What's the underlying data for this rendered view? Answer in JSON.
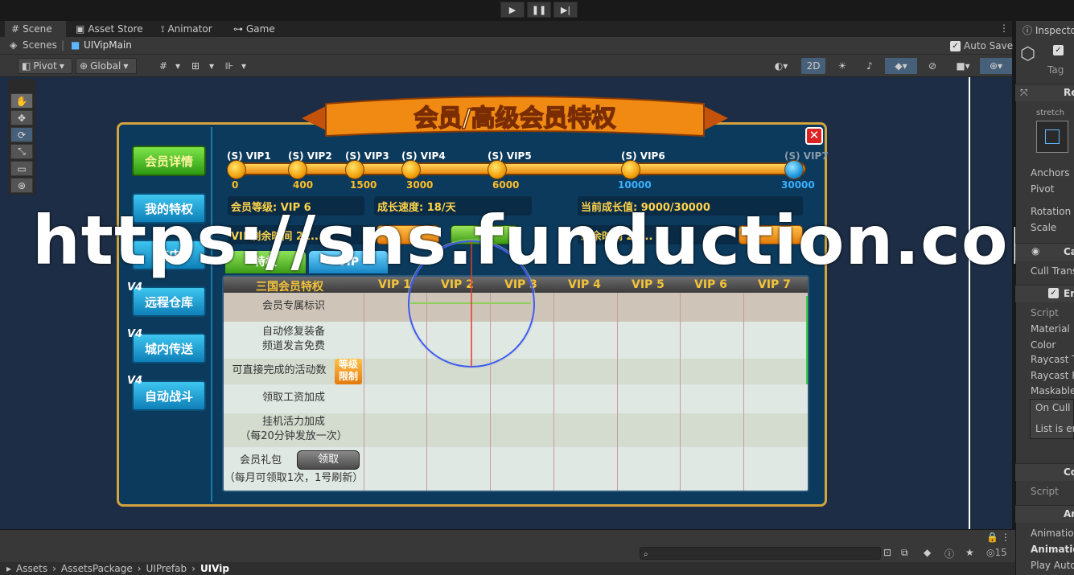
{
  "play_controls": {
    "play": "▶",
    "pause": "❚❚",
    "step": "▶|"
  },
  "tabs": [
    {
      "label": "Scene",
      "icon": "#"
    },
    {
      "label": "Asset Store",
      "icon": "🛍"
    },
    {
      "label": "Animator",
      "icon": "✈"
    },
    {
      "label": "Game",
      "icon": "🎮"
    }
  ],
  "breadcrumb": {
    "root": "Scenes",
    "current": "UIVipMain"
  },
  "auto_save": {
    "label": "Auto Save",
    "checked": true
  },
  "toolbar": {
    "pivot": "Pivot",
    "global": "Global",
    "mode_2d": "2D"
  },
  "game_ui": {
    "title": "会员/高级会员特权",
    "side_menu": [
      "会员详情",
      "我的特权",
      "商店",
      "远程仓库",
      "城内传送",
      "自动战斗"
    ],
    "badge": "V4",
    "vip_levels": [
      {
        "label": "VIP1",
        "value": "0"
      },
      {
        "label": "VIP2",
        "value": "400"
      },
      {
        "label": "VIP3",
        "value": "1500"
      },
      {
        "label": "VIP4",
        "value": "3000"
      },
      {
        "label": "VIP5",
        "value": "6000"
      },
      {
        "label": "VIP6",
        "value": "10000"
      },
      {
        "label": "VIP7",
        "value": "30000"
      }
    ],
    "s_prefix": "(S)",
    "member_level_label": "会员等级: VIP 6",
    "growth_speed_label": "成长速度: 18/天",
    "current_growth_label": "当前成长值: 9000/30000",
    "vip_remaining_label": "VIP剩余时间  22...",
    "remaining_label2": "剩余时间  22...",
    "sub_tabs": [
      "特权",
      "VIP"
    ],
    "table_header": "三国会员特权",
    "table_cols": [
      "VIP 1",
      "VIP 2",
      "VIP 3",
      "VIP 4",
      "VIP 5",
      "VIP 6",
      "VIP 7"
    ],
    "rows": [
      {
        "line1": "会员专属标识",
        "line2": ""
      },
      {
        "line1": "自动修复装备",
        "line2": "频道发言免费"
      },
      {
        "line1": "可直接完成的活动数",
        "line2": ""
      },
      {
        "line1": "领取工资加成",
        "line2": ""
      },
      {
        "line1": "挂机活力加成",
        "line2": "（每20分钟发放一次）"
      },
      {
        "line1": "会员礼包",
        "line2": "（每月可领取1次，1号刷新）"
      }
    ],
    "limit_tag": "等级限制",
    "claim_button": "领取"
  },
  "watermark": "https://sns.funduction.com",
  "inspector": {
    "title": "Inspecto",
    "tag": "Tag",
    "rect_header": "Re",
    "stretch": "stretch",
    "fields": [
      "Anchors",
      "Pivot",
      "Rotation",
      "Scale"
    ],
    "canvas_header": "Ca",
    "cull": "Cull Trans",
    "em_header": "Em",
    "em_fields": [
      "Script",
      "Material",
      "Color",
      "Raycast T",
      "Raycast P",
      "Maskable"
    ],
    "on_cull": "On Cull S",
    "list_empty": "List is er",
    "co_header": "Co",
    "co_script": "Script",
    "an_header": "An",
    "an_fields": [
      "Animation",
      "Animatio",
      "Play Auto"
    ]
  },
  "bottom": {
    "count": "15",
    "path": [
      "Assets",
      "AssetsPackage",
      "UIPrefab",
      "UIVip"
    ]
  },
  "colors": {
    "panel": "#0c3a5c",
    "gold": "#d3a33c",
    "viewport": "#1c2d45"
  }
}
